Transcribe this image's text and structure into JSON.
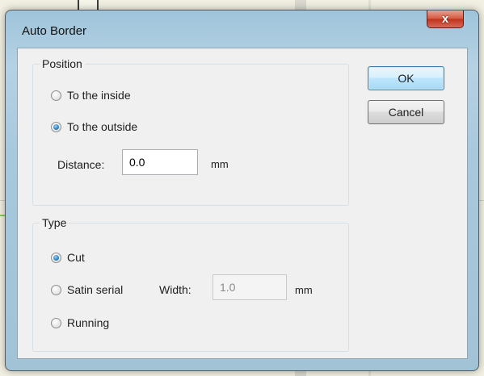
{
  "dialog": {
    "title": "Auto Border",
    "close_label": "x"
  },
  "position_group": {
    "legend": "Position",
    "options": [
      {
        "label": "To the inside",
        "checked": false
      },
      {
        "label": "To the outside",
        "checked": true
      }
    ],
    "distance_label": "Distance:",
    "distance_value": "0.0",
    "distance_unit": "mm"
  },
  "type_group": {
    "legend": "Type",
    "options": [
      {
        "label": "Cut",
        "checked": true
      },
      {
        "label": "Satin serial",
        "checked": false
      },
      {
        "label": "Running",
        "checked": false
      }
    ],
    "width_label": "Width:",
    "width_value": "1.0",
    "width_unit": "mm",
    "width_enabled": false
  },
  "buttons": {
    "ok": "OK",
    "cancel": "Cancel"
  }
}
